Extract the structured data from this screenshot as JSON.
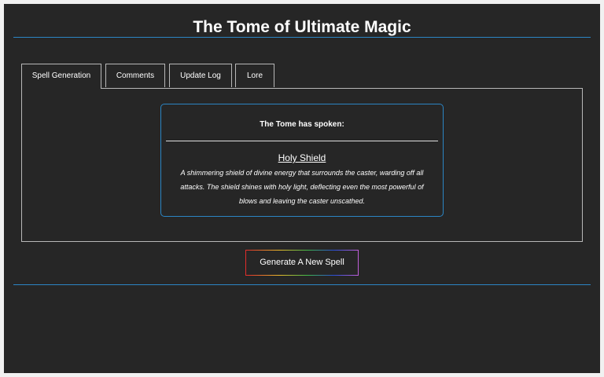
{
  "header": {
    "title": "The Tome of Ultimate Magic"
  },
  "tabs": [
    {
      "label": "Spell Generation",
      "active": true
    },
    {
      "label": "Comments",
      "active": false
    },
    {
      "label": "Update Log",
      "active": false
    },
    {
      "label": "Lore",
      "active": false
    }
  ],
  "result": {
    "heading": "The Tome has spoken:",
    "spell_name": "Holy Shield",
    "spell_description": "A shimmering shield of divine energy that surrounds the caster, warding off all attacks. The shield shines with holy light, deflecting even the most powerful of blows and leaving the caster unscathed."
  },
  "actions": {
    "generate_label": "Generate A New Spell"
  },
  "colors": {
    "background": "#262626",
    "accent_rule": "#2b85c4",
    "text": "#ffffff"
  }
}
